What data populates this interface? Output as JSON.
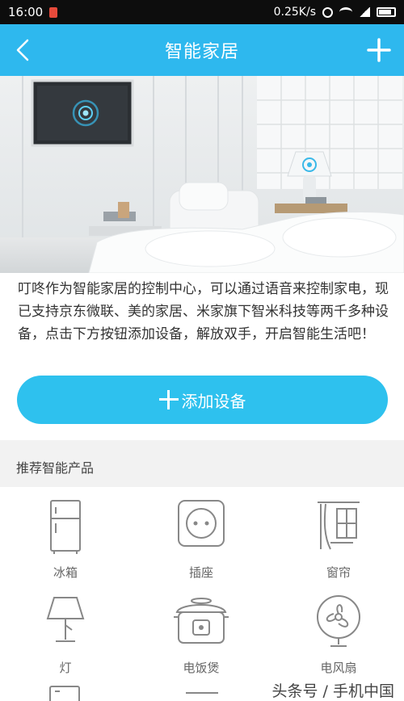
{
  "status_bar": {
    "time": "16:00",
    "network_speed": "0.25K/s",
    "icons": [
      "notification-icon",
      "alarm-icon",
      "wifi-icon",
      "signal-icon",
      "battery-icon"
    ]
  },
  "nav": {
    "title": "智能家居",
    "back_icon": "chevron-left-icon",
    "add_icon": "plus-icon",
    "bar_color": "#2eb8ee"
  },
  "intro_text": "叮咚作为智能家居的控制中心，可以通过语音来控制家电，现已支持京东微联、美的家居、米家旗下智米科技等两千多种设备，点击下方按钮添加设备，解放双手，开启智能生活吧！",
  "add_device_button": {
    "label": "添加设备",
    "color": "#2ec1ee"
  },
  "section": {
    "title": "推荐智能产品"
  },
  "products": [
    {
      "label": "冰箱",
      "icon": "refrigerator-icon"
    },
    {
      "label": "插座",
      "icon": "power-socket-icon"
    },
    {
      "label": "窗帘",
      "icon": "curtain-icon"
    },
    {
      "label": "灯",
      "icon": "lamp-icon"
    },
    {
      "label": "电饭煲",
      "icon": "rice-cooker-icon"
    },
    {
      "label": "电风扇",
      "icon": "fan-icon"
    }
  ],
  "watermark": "头条号 / 手机中国"
}
